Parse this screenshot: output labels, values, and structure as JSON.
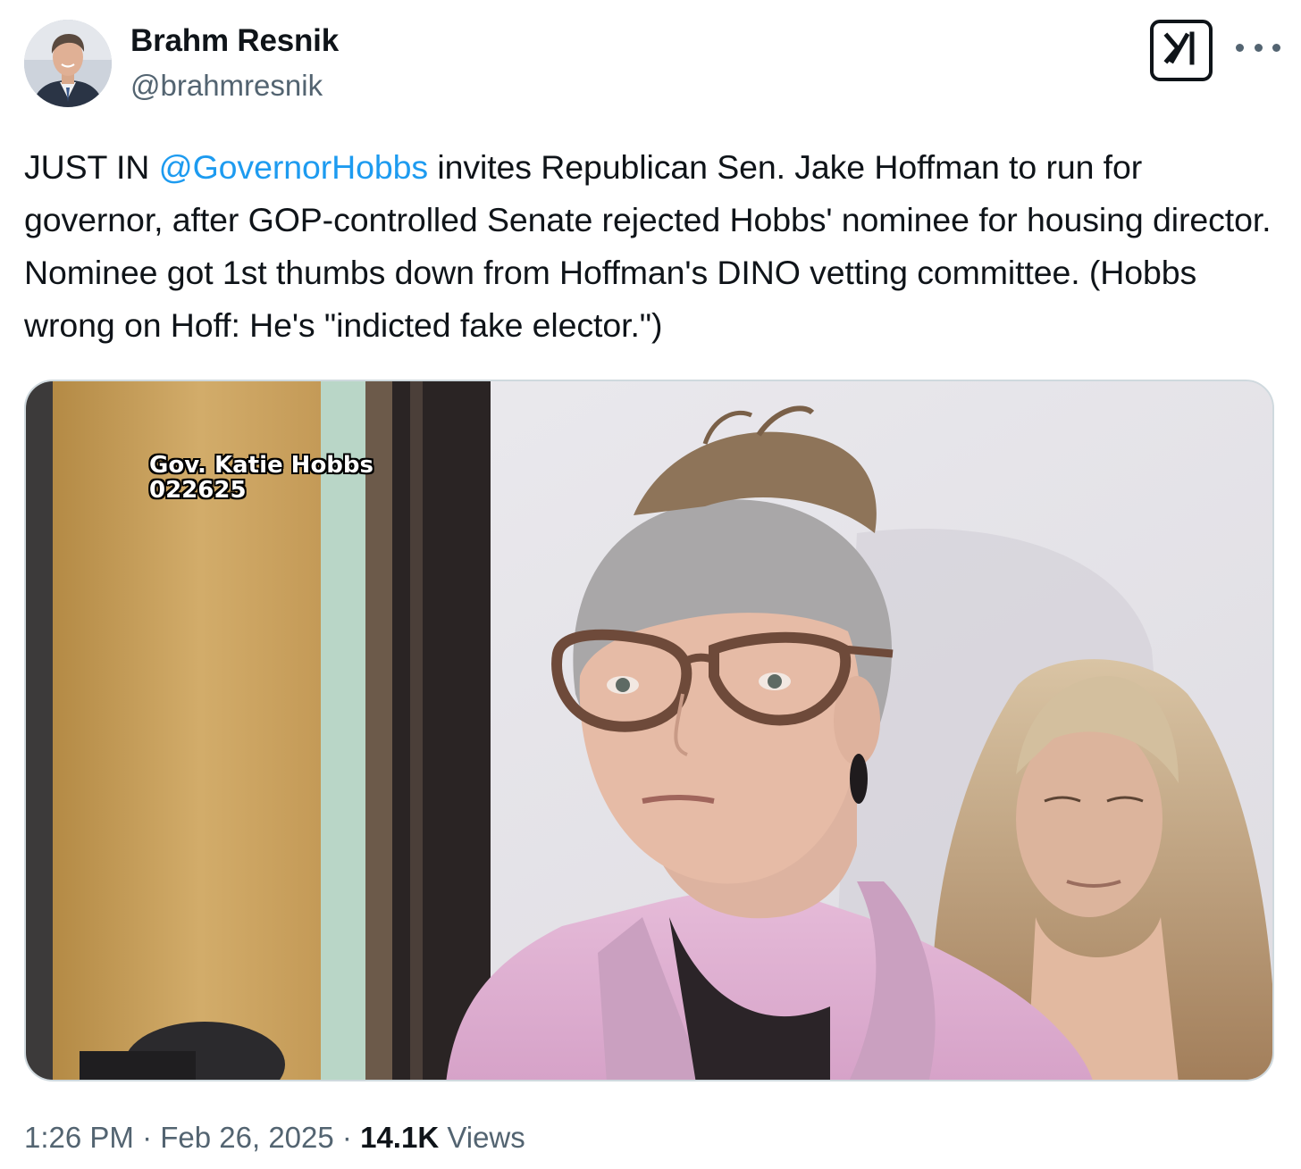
{
  "author": {
    "display_name": "Brahm Resnik",
    "handle": "@brahmresnik"
  },
  "header": {
    "grok_icon": "grok-icon",
    "more_icon": "more-horizontal-icon"
  },
  "tweet": {
    "text_before_mention": "JUST IN ",
    "mention": "@GovernorHobbs",
    "text_after_mention": " invites Republican Sen. Jake Hoffman to run for governor, after GOP-controlled Senate rejected Hobbs' nominee for housing director. Nominee got 1st thumbs down from Hoffman's DINO vetting committee. (Hobbs wrong on Hoff: He's \"indicted fake elector.\")"
  },
  "media": {
    "caption_line1": "Gov. Katie Hobbs",
    "caption_line2": "022625"
  },
  "meta": {
    "time": "1:26 PM",
    "separator": "·",
    "date": "Feb 26, 2025",
    "views_count": "14.1K",
    "views_label": "Views"
  },
  "colors": {
    "link": "#1d9bf0",
    "secondary_text": "#536471",
    "primary_text": "#0f1419"
  }
}
